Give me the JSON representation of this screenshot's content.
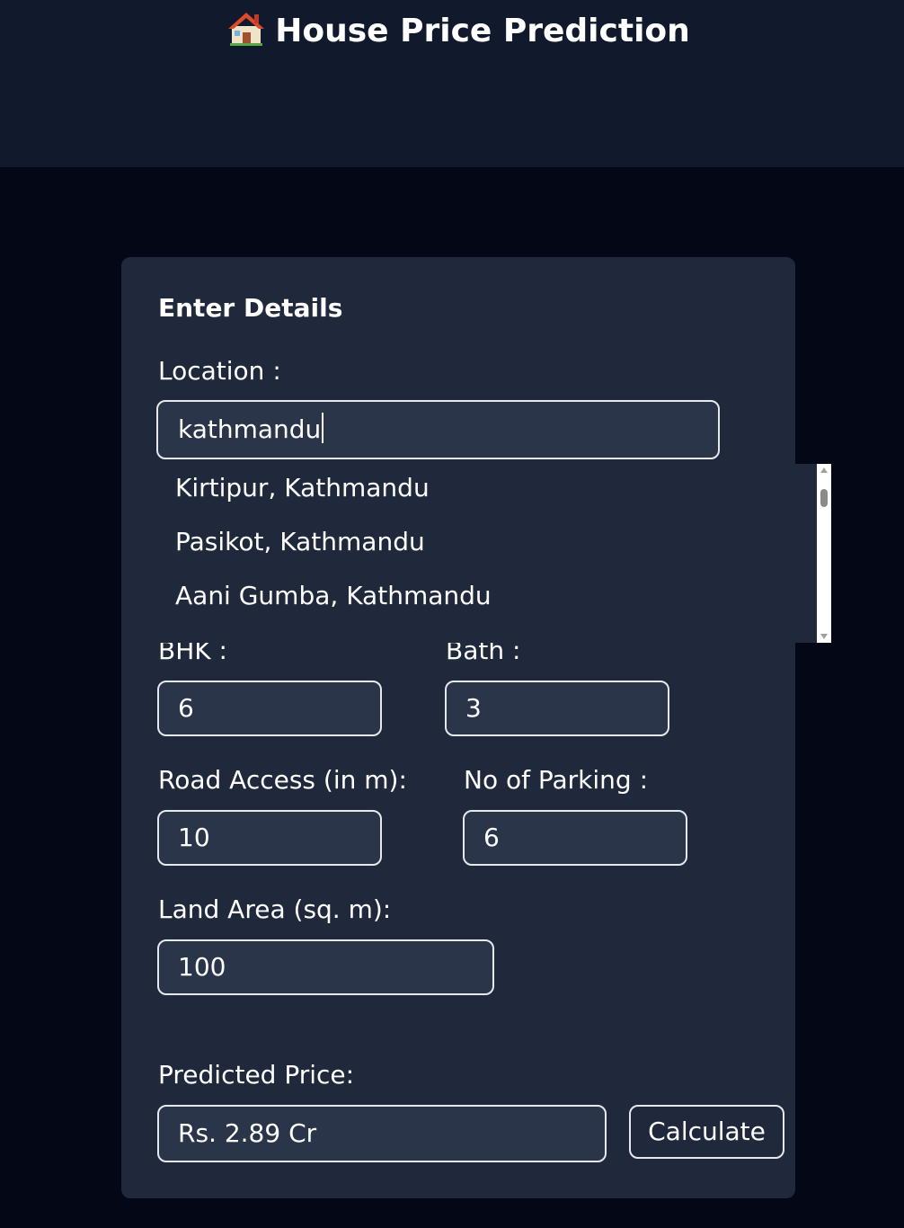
{
  "header": {
    "title": "House Price Prediction",
    "icon": "house-icon"
  },
  "form": {
    "section_title": "Enter Details",
    "location_label": "Location :",
    "location_value": "kathmandu",
    "suggestions": [
      "Kirtipur, Kathmandu",
      "Pasikot, Kathmandu",
      "Aani Gumba, Kathmandu"
    ],
    "bhk_label": "BHK :",
    "bhk_value": "6",
    "bath_label": "Bath :",
    "bath_value": "3",
    "road_label": "Road Access (in m):",
    "road_value": "10",
    "parking_label": "No of Parking :",
    "parking_value": "6",
    "area_label": "Land Area (sq. m):",
    "area_value": "100",
    "predicted_label": "Predicted Price:",
    "predicted_value": "Rs. 2.89  Cr",
    "calculate_label": "Calculate"
  },
  "colors": {
    "page_bg": "#030716",
    "header_bg": "#111a2d",
    "card_bg": "#1f293b",
    "field_bg": "#2a3549",
    "border": "#e6e8ec"
  }
}
